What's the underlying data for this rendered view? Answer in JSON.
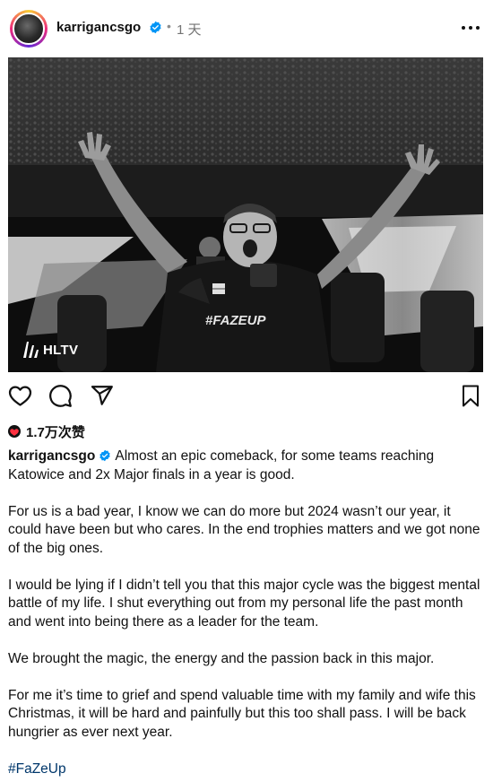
{
  "post": {
    "username": "karrigancsgo",
    "separator": "•",
    "time_ago": "1 天",
    "image_watermark": "HLTV",
    "jersey_text": "#FAZEUP",
    "likes": "1.7万次赞",
    "caption": {
      "username": "karrigancsgo",
      "paragraphs": [
        "Almost an epic comeback, for some teams reaching Katowice and 2x Major finals in a year is good.",
        "For us is a bad year, I know we can do more but 2024 wasn’t our year, it could have been but who cares. In the end trophies matters and we got none of the big ones.",
        "I would be lying if I didn’t tell you that this major cycle was the biggest mental battle of my life. I shut everything out from my personal life the past month and went into being there as a leader for the team.",
        "We brought the magic, the energy and the passion back in this major.",
        "For me it’s time to grief and spend valuable time with my family and wife this Christmas, it will be hard and painfully but this too shall pass. I will be back hungrier as ever next year."
      ],
      "hashtag": "#FaZeUp"
    }
  },
  "colors": {
    "verified_blue": "#0095f6",
    "hashtag_blue": "#00376b",
    "muted_text": "#737373"
  }
}
